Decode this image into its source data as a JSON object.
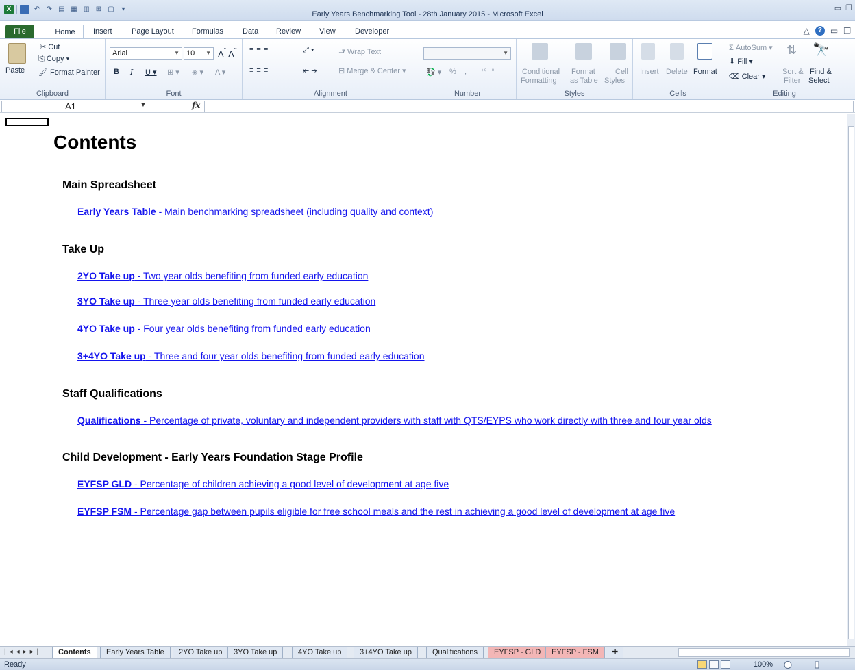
{
  "window": {
    "title": "Early Years Benchmarking Tool - 28th January 2015  -  Microsoft Excel"
  },
  "ribbon_tabs": [
    "File",
    "Home",
    "Insert",
    "Page Layout",
    "Formulas",
    "Data",
    "Review",
    "View",
    "Developer"
  ],
  "clipboard": {
    "paste": "Paste",
    "cut": "Cut",
    "copy": "Copy",
    "format_painter": "Format Painter",
    "label": "Clipboard"
  },
  "font": {
    "name": "Arial",
    "size": "10",
    "label": "Font"
  },
  "alignment": {
    "wrap": "Wrap Text",
    "merge": "Merge & Center",
    "label": "Alignment"
  },
  "number": {
    "format": "",
    "percent": "%",
    "comma": ",",
    "label": "Number"
  },
  "styles": {
    "conditional": "Conditional",
    "conditional2": "Formatting",
    "format_table": "Format",
    "format_table2": "as Table",
    "cell_styles": "Cell",
    "cell_styles2": "Styles",
    "label": "Styles"
  },
  "cells": {
    "insert": "Insert",
    "delete": "Delete",
    "format": "Format",
    "label": "Cells"
  },
  "editing": {
    "autosum": "AutoSum",
    "fill": "Fill",
    "clear": "Clear",
    "sort": "Sort &",
    "sort2": "Filter",
    "find": "Find &",
    "find2": "Select",
    "label": "Editing"
  },
  "formula_bar": {
    "name_box": "A1",
    "fx": "fx",
    "formula": ""
  },
  "sheet": {
    "heading": "Contents",
    "sections": [
      {
        "title": "Main Spreadsheet",
        "links": [
          {
            "name": "Early Years Table",
            "desc": " - Main benchmarking spreadsheet (including quality and context)"
          }
        ]
      },
      {
        "title": "Take Up",
        "links": [
          {
            "name": "2YO Take up",
            "desc": " - Two year olds benefiting from funded early education"
          },
          {
            "name": "3YO Take up",
            "desc": " - Three year olds benefiting from funded early education"
          },
          {
            "name": "4YO Take up",
            "desc": " - Four year olds benefiting from funded early education"
          },
          {
            "name": "3+4YO Take up",
            "desc": " - Three and four year olds benefiting from funded early education"
          }
        ]
      },
      {
        "title": "Staff Qualifications",
        "links": [
          {
            "name": "Qualifications",
            "desc": " - Percentage of private, voluntary and independent providers with staff with QTS/EYPS who work directly with three and four year olds"
          }
        ]
      },
      {
        "title": "Child Development - Early Years Foundation Stage Profile",
        "links": [
          {
            "name": "EYFSP GLD",
            "desc": " - Percentage of children achieving a good level of development at age five"
          },
          {
            "name": "EYFSP FSM",
            "desc": " - Percentage gap between pupils eligible for free school meals and the rest in achieving a good level of development at age five"
          }
        ]
      }
    ]
  },
  "sheet_tabs": [
    {
      "label": "Contents",
      "active": true,
      "color": "#ffffff"
    },
    {
      "label": "Early Years Table",
      "active": false,
      "color": "#dfe7f2"
    },
    {
      "label": "2YO Take up",
      "active": false,
      "color": "#dfe7f2"
    },
    {
      "label": "3YO Take up",
      "active": false,
      "color": "#dfe7f2"
    },
    {
      "label": "4YO Take up",
      "active": false,
      "color": "#dfe7f2"
    },
    {
      "label": "3+4YO Take up",
      "active": false,
      "color": "#dfe7f2"
    },
    {
      "label": "Qualifications",
      "active": false,
      "color": "#dfe7f2"
    },
    {
      "label": "EYFSP - GLD",
      "active": false,
      "color": "#f3b6b6"
    },
    {
      "label": "EYFSP - FSM",
      "active": false,
      "color": "#f3b6b6"
    }
  ],
  "status": {
    "ready": "Ready",
    "zoom": "100%"
  },
  "colors": {
    "link": "#1414ee",
    "file_tab": "#2a6a2e"
  }
}
